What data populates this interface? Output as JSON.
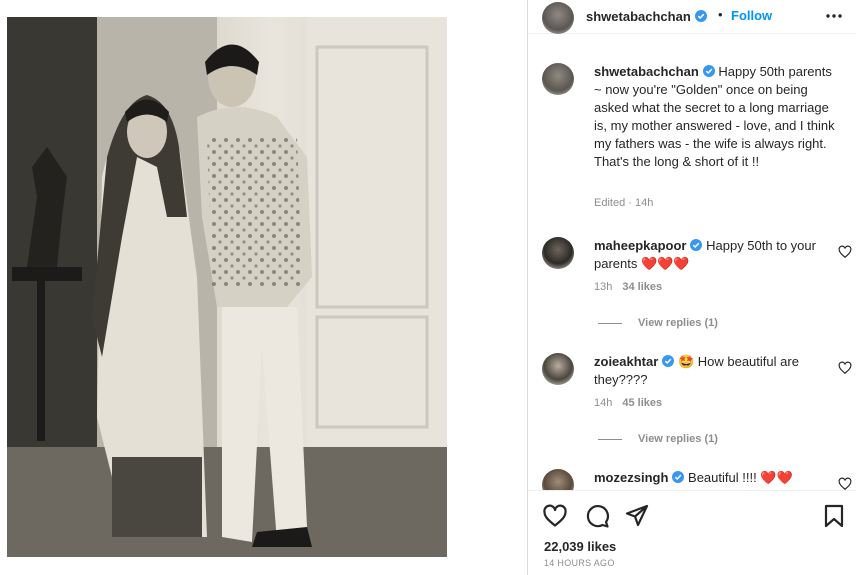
{
  "post": {
    "author": "shwetabachchan",
    "follow_label": "Follow",
    "separator": "•",
    "caption": "Happy 50th parents ~ now you're \"Golden\" once on being asked what the secret to a long marriage is, my mother answered - love, and I think my fathers was - the wife is always right. That's the long & short of it !!",
    "edited": "Edited",
    "caption_time": "14h",
    "likes": "22,039 likes",
    "posted_ago": "14 HOURS AGO"
  },
  "comments": [
    {
      "user": "maheepkapoor",
      "text": "Happy 50th to your parents",
      "emoji": "❤️❤️❤️",
      "time": "13h",
      "likes": "34 likes",
      "replies": "View replies (1)"
    },
    {
      "user": "zoieakhtar",
      "emoji_pre": "🤩",
      "text": "How beautiful are they????",
      "time": "14h",
      "likes": "45 likes",
      "replies": "View replies (1)"
    },
    {
      "user": "mozezsingh",
      "text": "Beautiful !!!!",
      "emoji": "❤️❤️"
    }
  ],
  "colors": {
    "accent": "#0095f6",
    "verified": "#3897f0",
    "muted": "#8e8e8e",
    "heart": "#ed1c24"
  },
  "icons": [
    "verified-badge-icon",
    "more-options-icon",
    "heart-icon",
    "comment-icon",
    "share-icon",
    "bookmark-icon"
  ]
}
